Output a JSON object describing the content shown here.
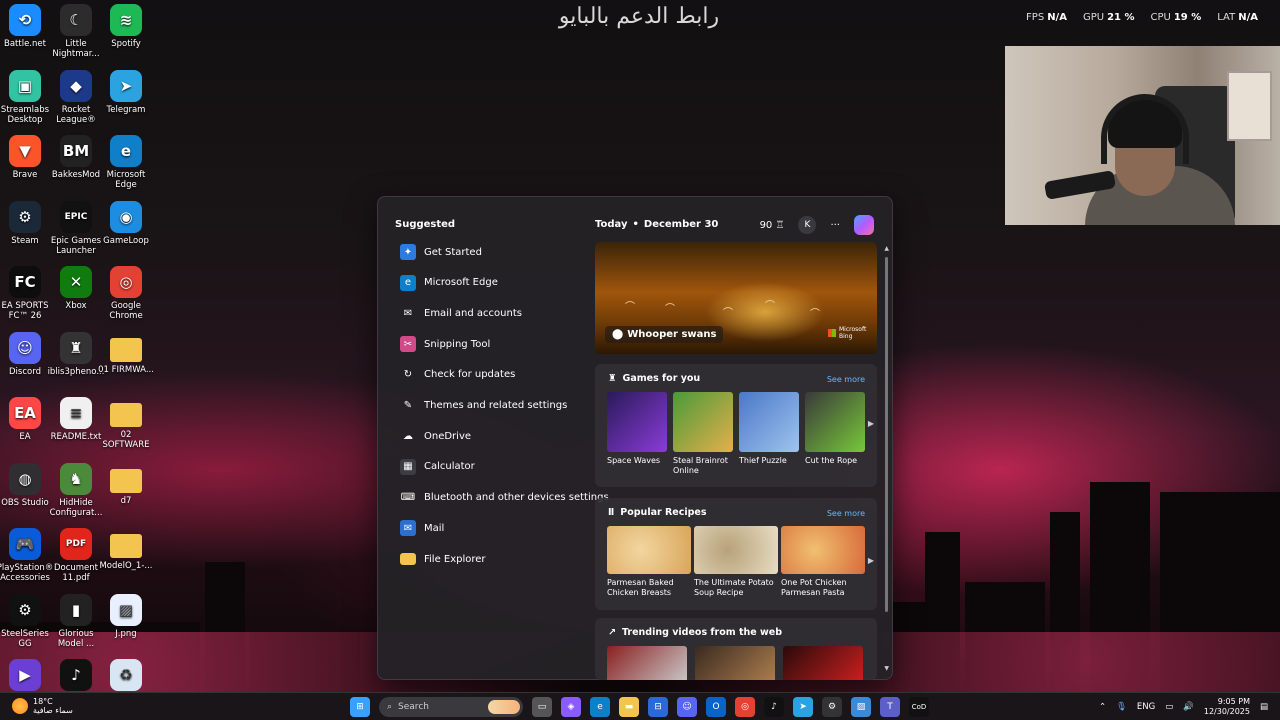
{
  "header": {
    "arabic_text": "رابط الدعم بالبايو"
  },
  "stats": [
    {
      "label": "FPS",
      "value": "N/A"
    },
    {
      "label": "GPU",
      "value": "21 %"
    },
    {
      "label": "CPU",
      "value": "19 %"
    },
    {
      "label": "LAT",
      "value": "N/A"
    }
  ],
  "desktop_icons": [
    {
      "label": "Battle.net",
      "glyph": "⟲",
      "color": "#1a8cff",
      "icon": "battlenet-icon"
    },
    {
      "label": "Little Nightmar...",
      "glyph": "☾",
      "color": "#2c2c2c",
      "icon": "little-nightmares-icon"
    },
    {
      "label": "Spotify",
      "glyph": "≋",
      "color": "#1db954",
      "icon": "spotify-icon"
    },
    {
      "label": "Streamlabs Desktop",
      "glyph": "▣",
      "color": "#31c3a2",
      "icon": "streamlabs-icon"
    },
    {
      "label": "Rocket League®",
      "glyph": "◆",
      "color": "#1d3a8a",
      "icon": "rocket-league-icon"
    },
    {
      "label": "Telegram",
      "glyph": "➤",
      "color": "#2aa3e0",
      "icon": "telegram-icon"
    },
    {
      "label": "Brave",
      "glyph": "▼",
      "color": "#fb542b",
      "icon": "brave-icon"
    },
    {
      "label": "BakkesMod",
      "glyph": "BM",
      "color": "#222222",
      "icon": "bakkesmod-icon"
    },
    {
      "label": "Microsoft Edge",
      "glyph": "e",
      "color": "#0f7fc9",
      "icon": "edge-icon"
    },
    {
      "label": "Steam",
      "glyph": "⚙",
      "color": "#1b2838",
      "icon": "steam-icon"
    },
    {
      "label": "Epic Games Launcher",
      "glyph": "EPIC",
      "color": "#111111",
      "icon": "epic-games-icon"
    },
    {
      "label": "GameLoop",
      "glyph": "◉",
      "color": "#1c8de0",
      "icon": "gameloop-icon"
    },
    {
      "label": "EA SPORTS FC™ 26",
      "glyph": "FC",
      "color": "#0d0d0d",
      "icon": "ea-fc-icon"
    },
    {
      "label": "Xbox",
      "glyph": "✕",
      "color": "#107c10",
      "icon": "xbox-icon"
    },
    {
      "label": "Google Chrome",
      "glyph": "◎",
      "color": "#e34133",
      "icon": "chrome-icon"
    },
    {
      "label": "Discord",
      "glyph": "☺",
      "color": "#5865f2",
      "icon": "discord-icon"
    },
    {
      "label": "iblis3pheno...",
      "glyph": "♜",
      "color": "#333333",
      "icon": "iblis-icon"
    },
    {
      "label": "01 FIRMWA...",
      "glyph": "",
      "color": "#f3c54e",
      "icon": "folder-icon"
    },
    {
      "label": "EA",
      "glyph": "EA",
      "color": "#ff4747",
      "icon": "ea-icon"
    },
    {
      "label": "README.txt",
      "glyph": "≡",
      "color": "#f0f0f0",
      "icon": "text-file-icon"
    },
    {
      "label": "02 SOFTWARE",
      "glyph": "",
      "color": "#f3c54e",
      "icon": "folder-icon"
    },
    {
      "label": "OBS Studio",
      "glyph": "◍",
      "color": "#302e31",
      "icon": "obs-icon"
    },
    {
      "label": "HidHide Configurat...",
      "glyph": "♞",
      "color": "#4b8a3a",
      "icon": "hidhide-icon"
    },
    {
      "label": "d7",
      "glyph": "",
      "color": "#f3c54e",
      "icon": "folder-icon"
    },
    {
      "label": "PlayStation® Accessories",
      "glyph": "🎮",
      "color": "#0a5bd8",
      "icon": "playstation-icon"
    },
    {
      "label": "Document 11.pdf",
      "glyph": "PDF",
      "color": "#e1251b",
      "icon": "pdf-icon"
    },
    {
      "label": "ModelO_1-...",
      "glyph": "",
      "color": "#f3c54e",
      "icon": "folder-icon"
    },
    {
      "label": "SteelSeries GG",
      "glyph": "⚙",
      "color": "#111111",
      "icon": "steelseries-icon"
    },
    {
      "label": "Glorious Model ...",
      "glyph": "▮",
      "color": "#222222",
      "icon": "glorious-icon"
    },
    {
      "label": "J.png",
      "glyph": "▨",
      "color": "#e8f0ff",
      "icon": "image-file-icon"
    },
    {
      "label": "",
      "glyph": "▶",
      "color": "#6b3fd4",
      "icon": "app-icon"
    },
    {
      "label": "",
      "glyph": "♪",
      "color": "#111111",
      "icon": "tiktok-icon"
    },
    {
      "label": "",
      "glyph": "♻",
      "color": "#d8e6f3",
      "icon": "recycle-bin-icon"
    }
  ],
  "start_menu": {
    "suggested_title": "Suggested",
    "suggested": [
      {
        "label": "Get Started",
        "icon": "get-started-icon",
        "color": "#2d7be0",
        "glyph": "✦"
      },
      {
        "label": "Microsoft Edge",
        "icon": "edge-icon",
        "color": "#0f7fc9",
        "glyph": "e"
      },
      {
        "label": "Email and accounts",
        "icon": "email-icon",
        "color": "transparent",
        "glyph": "✉"
      },
      {
        "label": "Snipping Tool",
        "icon": "snipping-tool-icon",
        "color": "#d14a8a",
        "glyph": "✂"
      },
      {
        "label": "Check for updates",
        "icon": "refresh-icon",
        "color": "transparent",
        "glyph": "↻"
      },
      {
        "label": "Themes and related settings",
        "icon": "brush-icon",
        "color": "transparent",
        "glyph": "✎"
      },
      {
        "label": "OneDrive",
        "icon": "onedrive-icon",
        "color": "transparent",
        "glyph": "☁"
      },
      {
        "label": "Calculator",
        "icon": "calculator-icon",
        "color": "#3c3c44",
        "glyph": "▦"
      },
      {
        "label": "Bluetooth and other devices settings",
        "icon": "bluetooth-icon",
        "color": "transparent",
        "glyph": "⌨"
      },
      {
        "label": "Mail",
        "icon": "mail-icon",
        "color": "#2b6fd1",
        "glyph": "✉"
      },
      {
        "label": "File Explorer",
        "icon": "folder-icon",
        "color": "#f3c54e",
        "glyph": ""
      }
    ],
    "today_label": "Today",
    "date": "December 30",
    "points": "90",
    "avatar_letter": "K",
    "more": "···",
    "hero": {
      "caption": "Whooper swans",
      "brand": "Microsoft Bing"
    },
    "games": {
      "title": "Games for you",
      "see_more": "See more",
      "items": [
        {
          "label": "Space Waves",
          "c1": "#2a1a5a",
          "c2": "#8a3cd8"
        },
        {
          "label": "Steal Brainrot Online",
          "c1": "#4a9a3a",
          "c2": "#e4b04a"
        },
        {
          "label": "Thief Puzzle",
          "c1": "#4a78c8",
          "c2": "#9fc4ee"
        },
        {
          "label": "Cut the Rope",
          "c1": "#3a3a3a",
          "c2": "#77c83a"
        }
      ]
    },
    "recipes": {
      "title": "Popular Recipes",
      "see_more": "See more",
      "items": [
        {
          "label": "Parmesan Baked Chicken Breasts",
          "c1": "#d9a55a",
          "c2": "#f2d6a0"
        },
        {
          "label": "The Ultimate Potato Soup Recipe",
          "c1": "#e8dcc2",
          "c2": "#b7a27a"
        },
        {
          "label": "One Pot Chicken Parmesan Pasta",
          "c1": "#d86a3a",
          "c2": "#f0c070"
        }
      ]
    },
    "trending": {
      "title": "Trending videos from the web",
      "items": [
        {
          "c1": "#8a2020",
          "c2": "#ccc"
        },
        {
          "c1": "#3a2a20",
          "c2": "#b08050"
        },
        {
          "c1": "#2a0a0a",
          "c2": "#d02020"
        }
      ]
    }
  },
  "taskbar": {
    "weather_temp": "18°C",
    "weather_desc": "سماء صافية",
    "search_placeholder": "Search",
    "apps": [
      {
        "icon": "windows-start-icon",
        "color": "#3aa0ff",
        "glyph": "⊞"
      },
      {
        "icon": "task-view-icon",
        "color": "#555",
        "glyph": "▭"
      },
      {
        "icon": "copilot-icon",
        "color": "#8a5cff",
        "glyph": "◈"
      },
      {
        "icon": "edge-icon",
        "color": "#0f7fc9",
        "glyph": "e"
      },
      {
        "icon": "file-explorer-icon",
        "color": "#f3c54e",
        "glyph": "▬"
      },
      {
        "icon": "store-icon",
        "color": "#2a6ad8",
        "glyph": "⊟"
      },
      {
        "icon": "discord-icon",
        "color": "#5865f2",
        "glyph": "☺"
      },
      {
        "icon": "outlook-icon",
        "color": "#0a64c8",
        "glyph": "O"
      },
      {
        "icon": "chrome-icon",
        "color": "#e34133",
        "glyph": "◎"
      },
      {
        "icon": "tiktok-icon",
        "color": "#111",
        "glyph": "♪"
      },
      {
        "icon": "telegram-icon",
        "color": "#2aa3e0",
        "glyph": "➤"
      },
      {
        "icon": "steelseries-icon",
        "color": "#333",
        "glyph": "⚙"
      },
      {
        "icon": "photos-icon",
        "color": "#3a8ad8",
        "glyph": "▨"
      },
      {
        "icon": "teams-icon",
        "color": "#5b5fc7",
        "glyph": "T"
      },
      {
        "icon": "call-of-duty-icon",
        "color": "#111",
        "glyph": "CoD"
      }
    ],
    "lang": "ENG",
    "time": "9:05 PM",
    "date": "12/30/2025"
  }
}
